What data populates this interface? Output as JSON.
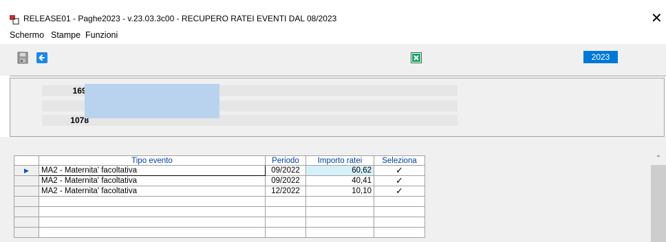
{
  "window": {
    "title": "RELEASE01 - Paghe2023 - v.23.03.3c00 - RECUPERO RATEI EVENTI DAL 08/2023",
    "close_glyph": "✕"
  },
  "menu": {
    "items": [
      "Schermo",
      "Stampe",
      "Funzioni"
    ]
  },
  "toolbar": {
    "save_icon": "save-icon",
    "back_icon": "back-arrow-icon",
    "excel_icon": "excel-icon",
    "year": "2023"
  },
  "header": {
    "company_code": "169",
    "company_code_suffix": ".",
    "employee_code": "1078"
  },
  "grid": {
    "columns": [
      "Tipo evento",
      "Periodo",
      "Importo ratei",
      "Seleziona"
    ],
    "rows": [
      {
        "tipo": "MA2 - Maternita' facoltativa",
        "periodo": "09/2022",
        "importo": "60,62",
        "seleziona": "✓"
      },
      {
        "tipo": "MA2 - Maternita' facoltativa",
        "periodo": "09/2022",
        "importo": "40,41",
        "seleziona": "✓"
      },
      {
        "tipo": "MA2 - Maternita' facoltativa",
        "periodo": "12/2022",
        "importo": "10,10",
        "seleziona": "✓"
      }
    ],
    "current_row_marker": "▶"
  },
  "colors": {
    "accent": "#0078d7",
    "selection_highlight": "#b9d3ee",
    "selected_cell": "#d6f0f8",
    "header_text": "#0040a0"
  }
}
